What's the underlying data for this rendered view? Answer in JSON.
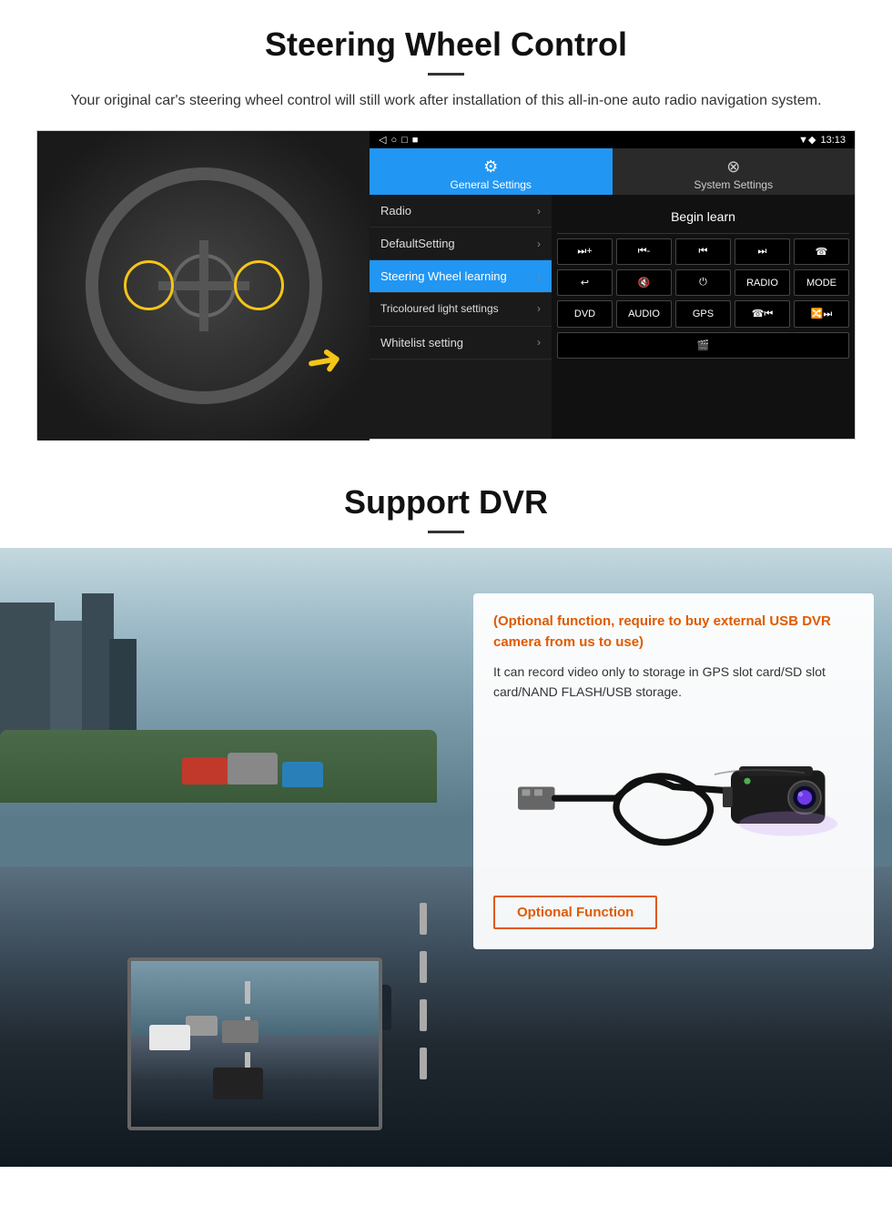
{
  "steering": {
    "title": "Steering Wheel Control",
    "subtitle": "Your original car's steering wheel control will still work after installation of this all-in-one auto radio navigation system.",
    "statusbar": {
      "nav_buttons": [
        "◁",
        "○",
        "□",
        "■"
      ],
      "time": "13:13",
      "icons": "▼ ◆"
    },
    "tabs": [
      {
        "icon": "⚙",
        "label": "General Settings",
        "active": true
      },
      {
        "icon": "⊗",
        "label": "System Settings",
        "active": false
      }
    ],
    "menu_items": [
      {
        "label": "Radio",
        "active": false
      },
      {
        "label": "DefaultSetting",
        "active": false
      },
      {
        "label": "Steering Wheel learning",
        "active": true
      },
      {
        "label": "Tricoloured light settings",
        "active": false
      },
      {
        "label": "Whitelist setting",
        "active": false
      }
    ],
    "begin_learn_btn": "Begin learn",
    "control_rows": [
      [
        "⏮+",
        "⏮-",
        "⏮⏮",
        "⏭⏭",
        "☎"
      ],
      [
        "↩",
        "🔇",
        "⏻",
        "RADIO",
        "MODE"
      ],
      [
        "DVD",
        "AUDIO",
        "GPS",
        "☎⏮",
        "🔀⏭"
      ]
    ],
    "extra_btn": "🎬"
  },
  "dvr": {
    "title": "Support DVR",
    "optional_text": "(Optional function, require to buy external USB DVR camera from us to use)",
    "description": "It can record video only to storage in GPS slot card/SD slot card/NAND FLASH/USB storage.",
    "optional_function_btn": "Optional Function"
  }
}
